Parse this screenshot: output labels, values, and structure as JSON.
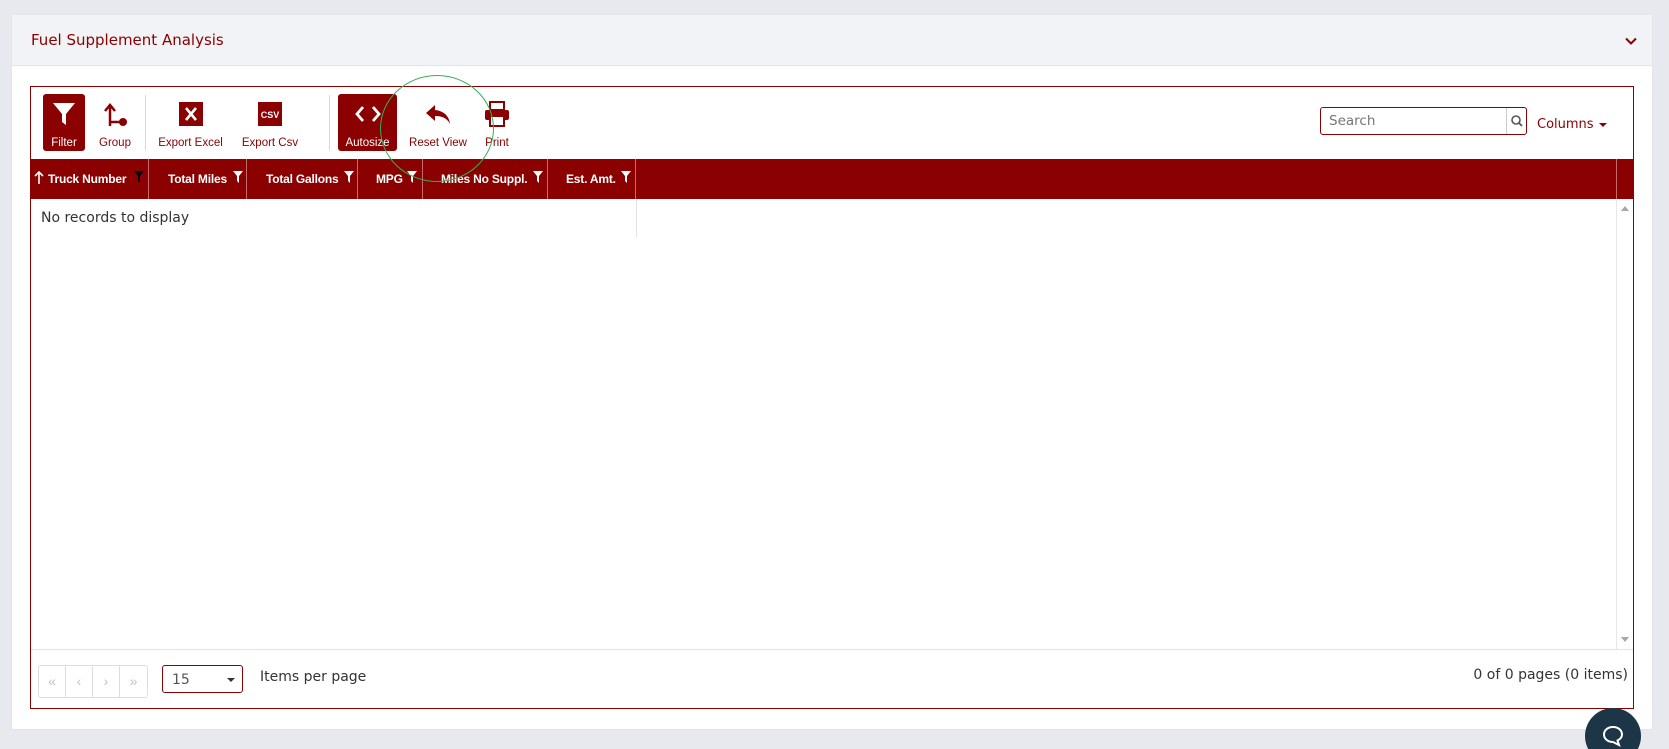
{
  "panel": {
    "title": "Fuel Supplement Analysis"
  },
  "toolbar": {
    "filter": "Filter",
    "group": "Group",
    "export_excel": "Export Excel",
    "export_csv": "Export Csv",
    "csv_icon_text": "CSV",
    "autosize": "Autosize",
    "reset_view": "Reset View",
    "print": "Print",
    "search_placeholder": "Search",
    "columns": "Columns"
  },
  "columns": [
    "Truck Number",
    "Total Miles",
    "Total Gallons",
    "MPG",
    "Miles No Suppl.",
    "Est. Amt."
  ],
  "grid": {
    "empty_message": "No records to display"
  },
  "footer": {
    "page_size": "15",
    "items_per_page": "Items per page",
    "page_info": "0 of 0 pages (0 items)",
    "first": "«",
    "prev": "‹",
    "next": "›",
    "last": "»"
  },
  "colors": {
    "brand": "#8b0000",
    "highlight": "#33b05a",
    "chat": "#1c3647"
  }
}
